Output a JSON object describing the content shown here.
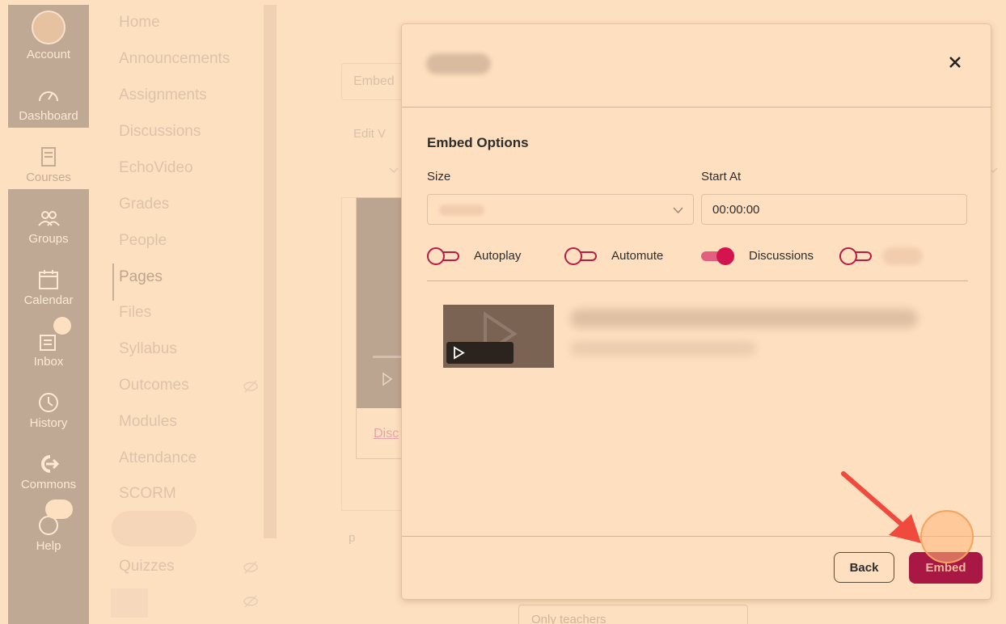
{
  "global_nav": {
    "items": [
      {
        "label": "Account",
        "icon": "avatar"
      },
      {
        "label": "Dashboard",
        "icon": "dashboard-icon"
      },
      {
        "label": "Courses",
        "icon": "courses-icon",
        "active": true
      },
      {
        "label": "Groups",
        "icon": "groups-icon"
      },
      {
        "label": "Calendar",
        "icon": "calendar-icon"
      },
      {
        "label": "Inbox",
        "icon": "inbox-icon"
      },
      {
        "label": "History",
        "icon": "history-icon"
      },
      {
        "label": "Commons",
        "icon": "commons-icon"
      },
      {
        "label": "Help",
        "icon": "help-icon"
      }
    ]
  },
  "course_nav": {
    "items": [
      {
        "label": "Home"
      },
      {
        "label": "Announcements"
      },
      {
        "label": "Assignments"
      },
      {
        "label": "Discussions"
      },
      {
        "label": "EchoVideo"
      },
      {
        "label": "Grades"
      },
      {
        "label": "People"
      },
      {
        "label": "Pages",
        "current": true
      },
      {
        "label": "Files"
      },
      {
        "label": "Syllabus"
      },
      {
        "label": "Outcomes",
        "hidden_from_students": true
      },
      {
        "label": "Modules"
      },
      {
        "label": "Attendance"
      },
      {
        "label": "SCORM"
      },
      {
        "label": "Quizzes",
        "hidden_from_students": true
      }
    ]
  },
  "background_page": {
    "input_text": "Embed",
    "menu_text": "Edit  V",
    "link_text": "Disc",
    "p_text": "p",
    "select_text": "Only teachers"
  },
  "modal": {
    "section_heading": "Embed Options",
    "size_label": "Size",
    "start_at_label": "Start At",
    "start_at_value": "00:00:00",
    "toggles": [
      {
        "label": "Autoplay",
        "on": false
      },
      {
        "label": "Automute",
        "on": false
      },
      {
        "label": "Discussions",
        "on": true
      },
      {
        "label": "",
        "on": false
      }
    ],
    "back_label": "Back",
    "embed_label": "Embed"
  },
  "colors": {
    "accent": "#a91844",
    "toggle_on": "#d5134e",
    "annotation_arrow": "#ef4a3c"
  }
}
